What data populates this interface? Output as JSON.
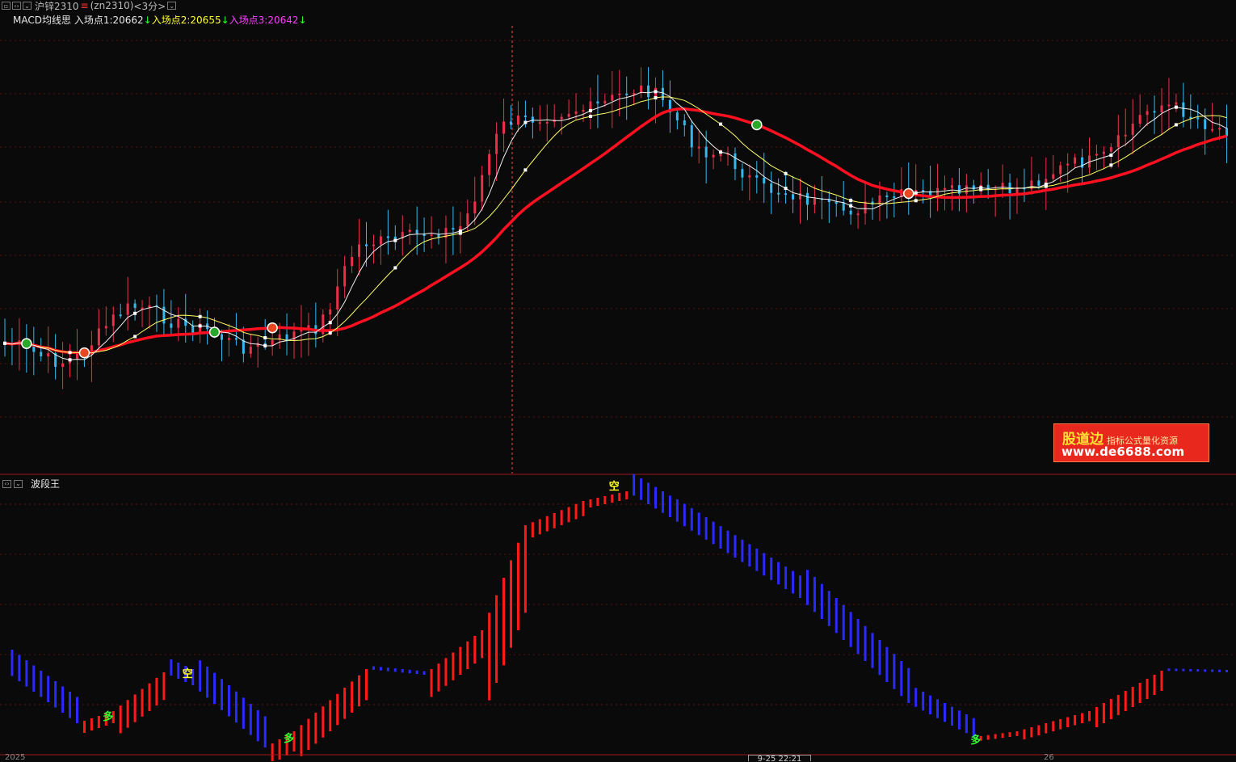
{
  "header": {
    "symbol": "沪锌2310",
    "flag": "≡",
    "code": "(zn2310)",
    "period": "<3分>"
  },
  "legend": {
    "indicator": "MACD均线思",
    "entry1": "入场点1:20662",
    "entry2": "入场点2:20655",
    "entry3": "入场点3:20642",
    "arrow": "↓"
  },
  "sub_panel": {
    "title": "波段王"
  },
  "watermark": {
    "brand": "股道边",
    "tagline": "指标公式量化资源",
    "url": "www.de6688.com"
  },
  "axis": {
    "left_date": "2025",
    "cursor_time": "9-25 22:21",
    "right_date": "26"
  },
  "colors": {
    "background": "#0a0a0a",
    "up_candle": "#e8304a",
    "down_candle": "#35b8f0",
    "ma_white": "#f0f0f0",
    "ma_yellow": "#ffff66",
    "ma_red_thick": "#ff1020",
    "wave_up": "#ff1a1a",
    "wave_down": "#2a2aff",
    "signal_long": "#33ff33",
    "signal_short": "#ffff22",
    "cursor_line": "#ff4444",
    "grid": "#5a1010"
  },
  "chart_data": [
    {
      "type": "candlestick",
      "title": "沪锌2310 (zn2310) <3分>",
      "series": [
        {
          "name": "MACD均线思",
          "kind": "price_overlay"
        }
      ],
      "signals": [
        {
          "kind": "long_circle",
          "index": 3
        },
        {
          "kind": "short_circle",
          "index": 11
        },
        {
          "kind": "long_circle",
          "index": 29
        },
        {
          "kind": "short_circle",
          "index": 37
        },
        {
          "kind": "long_circle",
          "index": 104
        },
        {
          "kind": "short_circle",
          "index": 125
        }
      ]
    },
    {
      "type": "bar",
      "title": "波段王",
      "signals": [
        {
          "label": "多",
          "index": 14,
          "kind": "long"
        },
        {
          "label": "空",
          "index": 25,
          "kind": "short"
        },
        {
          "label": "多",
          "index": 39,
          "kind": "long"
        },
        {
          "label": "空",
          "index": 84,
          "kind": "short"
        },
        {
          "label": "多",
          "index": 134,
          "kind": "long"
        }
      ]
    }
  ]
}
